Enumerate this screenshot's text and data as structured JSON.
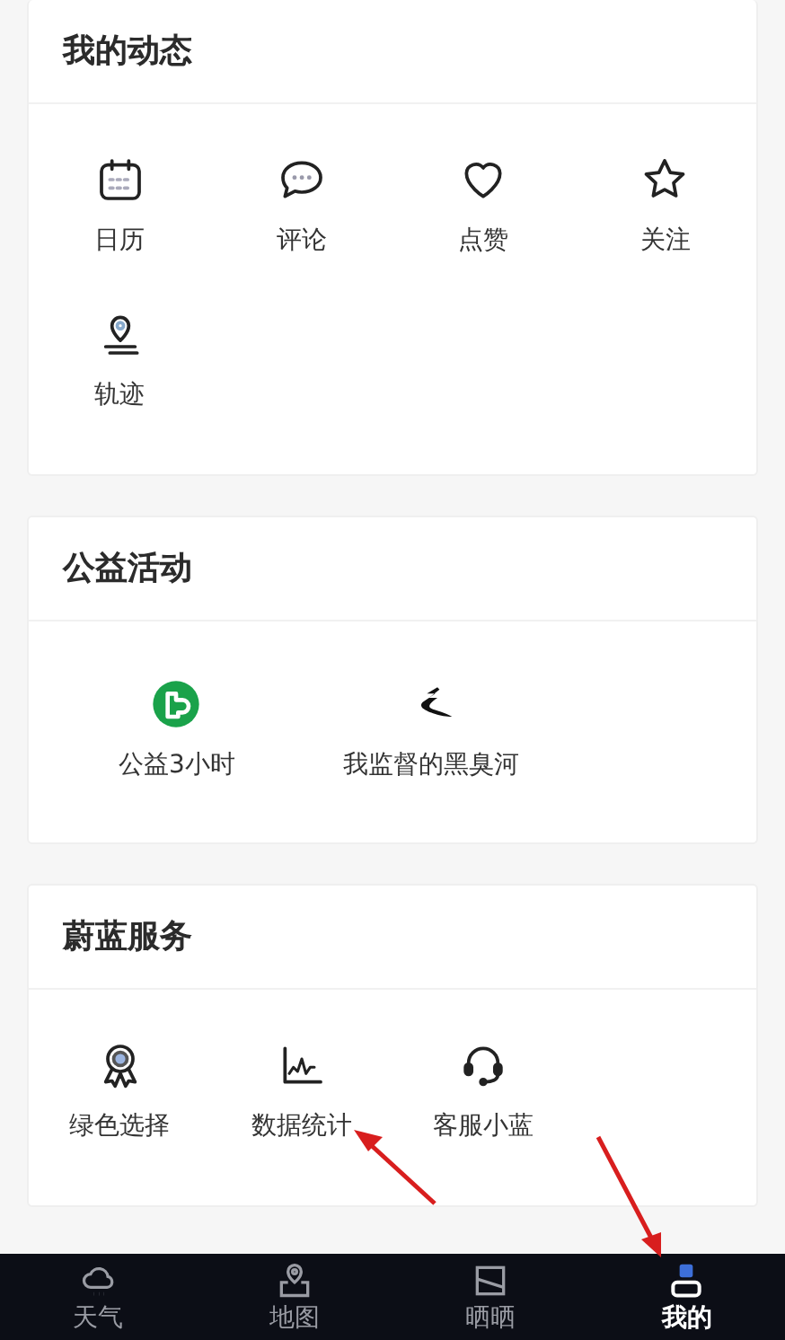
{
  "sections": [
    {
      "title": "我的动态",
      "kind": "grid",
      "items": [
        {
          "label": "日历"
        },
        {
          "label": "评论"
        },
        {
          "label": "点赞"
        },
        {
          "label": "关注"
        },
        {
          "label": "轨迹"
        }
      ]
    },
    {
      "title": "公益活动",
      "kind": "flow",
      "items": [
        {
          "label": "公益3小时"
        },
        {
          "label": "我监督的黑臭河"
        }
      ]
    },
    {
      "title": "蔚蓝服务",
      "kind": "grid",
      "items": [
        {
          "label": "绿色选择"
        },
        {
          "label": "数据统计"
        },
        {
          "label": "客服小蓝"
        }
      ]
    }
  ],
  "tabs": [
    {
      "label": "天气",
      "selected": false
    },
    {
      "label": "地图",
      "selected": false
    },
    {
      "label": "晒晒",
      "selected": false
    },
    {
      "label": "我的",
      "selected": true
    }
  ]
}
